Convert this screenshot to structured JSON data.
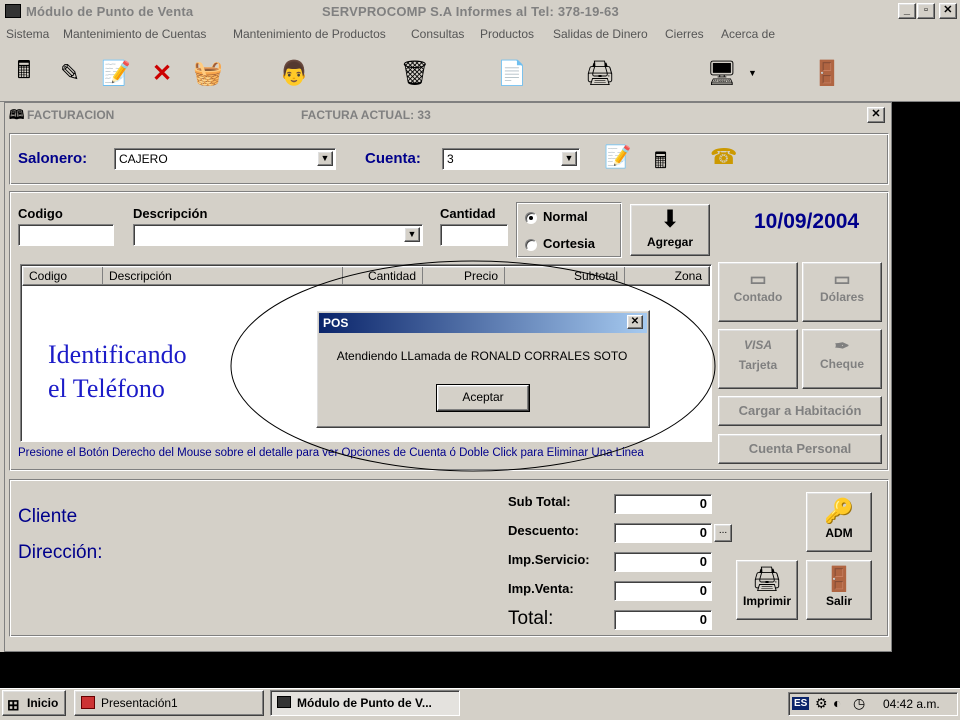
{
  "title_bar": {
    "title": "Módulo de Punto de Venta",
    "company": "SERVPROCOMP S.A  Informes al Tel: 378-19-63"
  },
  "menu": [
    "Sistema",
    "Mantenimiento de Cuentas",
    "Mantenimiento de Productos",
    "Consultas",
    "Productos",
    "Salidas de Dinero",
    "Cierres",
    "Acerca de"
  ],
  "child": {
    "title": "FACTURACION",
    "factura": "FACTURA ACTUAL:  33"
  },
  "top_form": {
    "salonero_label": "Salonero:",
    "salonero_value": "CAJERO",
    "cuenta_label": "Cuenta:",
    "cuenta_value": "3"
  },
  "entry": {
    "codigo_label": "Codigo",
    "descripcion_label": "Descripción",
    "cantidad_label": "Cantidad",
    "radio_normal": "Normal",
    "radio_cortesia": "Cortesia",
    "agregar_label": "Agregar",
    "date": "10/09/2004"
  },
  "grid": {
    "columns": [
      "Codigo",
      "Descripción",
      "Cantidad",
      "Precio",
      "Subtotal",
      "Zona"
    ],
    "hint": "Presione el Botón Derecho del Mouse sobre el detalle para ver Opciones de Cuenta ó Doble Click para Eliminar Una Linea"
  },
  "payment": {
    "contado": "Contado",
    "dolares": "Dólares",
    "tarjeta": "Tarjeta",
    "cheque": "Cheque",
    "habitacion": "Cargar a Habitación",
    "personal": "Cuenta Personal"
  },
  "dialog": {
    "title": "POS",
    "message": "Atendiendo LLamada de  RONALD CORRALES SOTO",
    "ok": "Aceptar"
  },
  "annotation": {
    "line1": "Identificando",
    "line2": "el Teléfono"
  },
  "bottom": {
    "cliente": "Cliente",
    "direccion": "Dirección:",
    "subtotal_label": "Sub Total:",
    "subtotal": "0",
    "descuento_label": "Descuento:",
    "descuento": "0",
    "more": "...",
    "servicio_label": "Imp.Servicio:",
    "servicio": "0",
    "venta_label": "Imp.Venta:",
    "venta": "0",
    "total_label": "Total:",
    "total": "0",
    "adm": "ADM",
    "imprimir": "Imprimir",
    "salir": "Salir"
  },
  "taskbar": {
    "start": "Inicio",
    "task1": "Presentación1",
    "task2": "Módulo de Punto de V...",
    "lang": "ES",
    "clock": "04:42 a.m."
  }
}
